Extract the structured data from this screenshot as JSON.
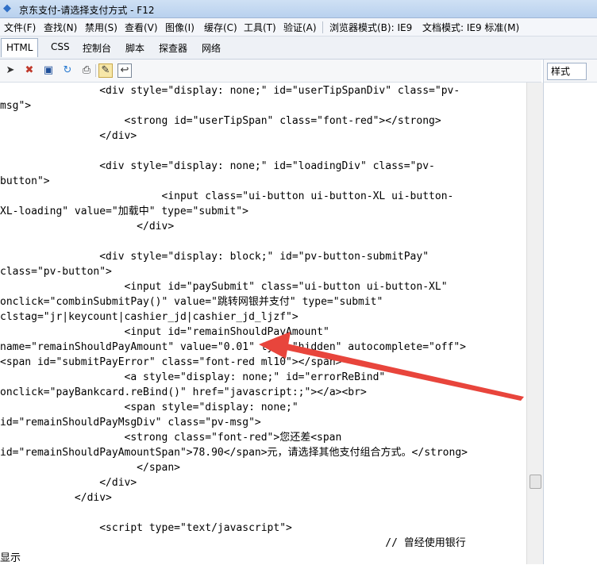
{
  "window": {
    "title": "京东支付-请选择支付方式 - F12"
  },
  "menubar": {
    "items": [
      "文件(F)",
      "查找(N)",
      "禁用(S)",
      "查看(V)",
      "图像(I)",
      "缓存(C)",
      "工具(T)",
      "验证(A)"
    ],
    "browser_mode": "浏览器模式(B): IE9",
    "document_mode": "文档模式: IE9 标准(M)"
  },
  "tabs": [
    "HTML",
    "CSS",
    "控制台",
    "脚本",
    "探查器",
    "网络"
  ],
  "active_tab": "HTML",
  "toolbar": {
    "icons": [
      "select-element-icon",
      "clear-icon",
      "save-icon",
      "refresh-icon",
      "view-source-icon",
      "edit-icon",
      "word-wrap-icon"
    ]
  },
  "right_panel": {
    "tab_label": "样式"
  },
  "code_lines": [
    "                <div style=\"display: none;\" id=\"userTipSpanDiv\" class=\"pv-",
    "msg\">",
    "                    <strong id=\"userTipSpan\" class=\"font-red\"></strong>",
    "                </div>",
    "",
    "                <div style=\"display: none;\" id=\"loadingDiv\" class=\"pv-",
    "button\">",
    "                          <input class=\"ui-button ui-button-XL ui-button-",
    "XL-loading\" value=\"加载中\" type=\"submit\">",
    "                      </div>",
    "",
    "                <div style=\"display: block;\" id=\"pv-button-submitPay\"",
    "class=\"pv-button\">",
    "                    <input id=\"paySubmit\" class=\"ui-button ui-button-XL\"",
    "onclick=\"combinSubmitPay()\" value=\"跳转网银并支付\" type=\"submit\"",
    "clstag=\"jr|keycount|cashier_jd|cashier_jd_ljzf\">",
    "                    <input id=\"remainShouldPayAmount\"",
    "name=\"remainShouldPayAmount\" value=\"0.01\" type=\"hidden\" autocomplete=\"off\">",
    "<span id=\"submitPayError\" class=\"font-red ml10\"></span>",
    "                    <a style=\"display: none;\" id=\"errorReBind\"",
    "onclick=\"payBankcard.reBind()\" href=\"javascript:;\"></a><br>",
    "                    <span style=\"display: none;\"",
    "id=\"remainShouldPayMsgDiv\" class=\"pv-msg\">",
    "                    <strong class=\"font-red\">您还差<span",
    "id=\"remainShouldPayAmountSpan\">78.90</span>元，请选择其他支付组合方式。</strong>",
    "                      </span>",
    "                </div>",
    "            </div>",
    "",
    "                <script type=\"text/javascript\">",
    "                                                              // 曾经使用银行",
    "显示"
  ]
}
